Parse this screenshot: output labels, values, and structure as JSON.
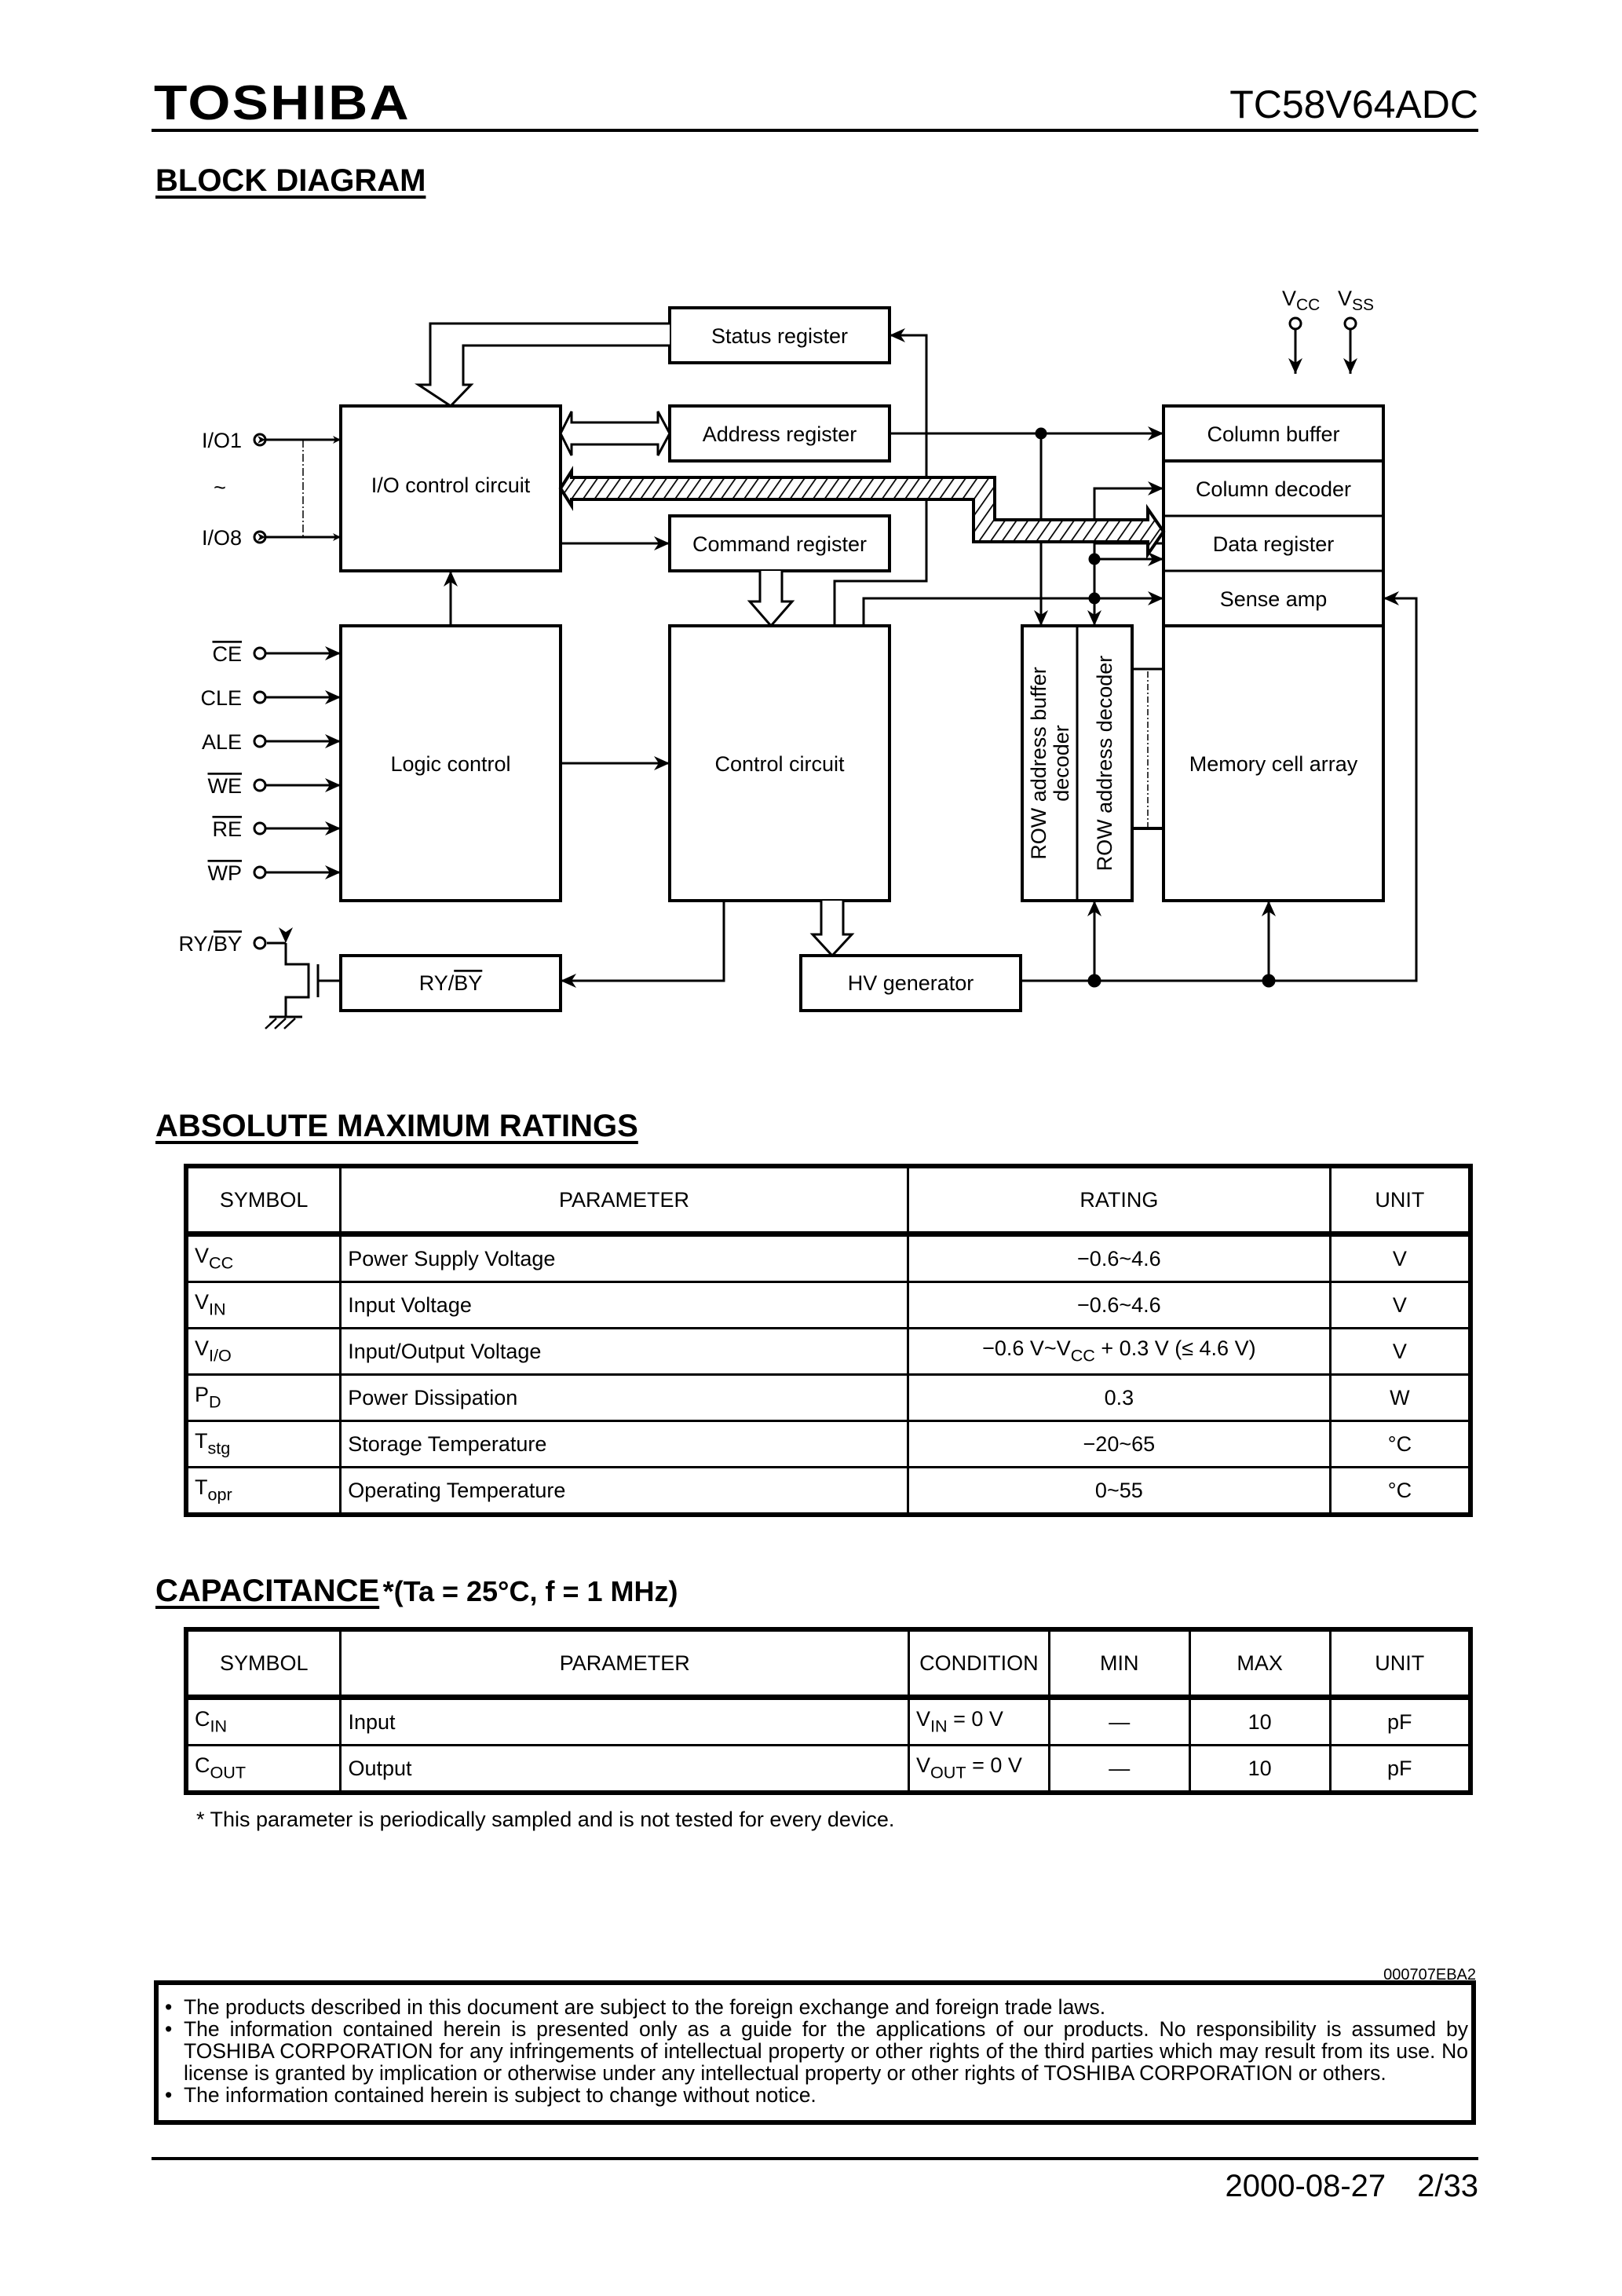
{
  "header": {
    "brand": "TOSHIBA",
    "part_number": "TC58V64ADC"
  },
  "block_diagram": {
    "title": "BLOCK DIAGRAM",
    "pins": {
      "io1": "I/O1",
      "io_tilde": "~",
      "io8": "I/O8",
      "ce": "CE",
      "cle": "CLE",
      "ale": "ALE",
      "we": "WE",
      "re": "RE",
      "wp": "WP",
      "ryby_ry": "RY/",
      "ryby_by": "BY",
      "vcc_main": "V",
      "vcc_sub": "CC",
      "vss_main": "V",
      "vss_sub": "SS"
    },
    "blocks": {
      "status_register": "Status register",
      "address_register": "Address register",
      "command_register": "Command register",
      "io_control": "I/O control circuit",
      "logic_control": "Logic control",
      "control_circuit": "Control circuit",
      "ryby_ry": "RY/",
      "ryby_by": "BY",
      "hv_generator": "HV generator",
      "column_buffer": "Column buffer",
      "column_decoder": "Column decoder",
      "data_register": "Data register",
      "sense_amp": "Sense amp",
      "memory_cell_array": "Memory cell array",
      "row_buffer_line1": "ROW address buffer",
      "row_buffer_line2": "decoder",
      "row_decoder": "ROW address decoder"
    }
  },
  "abs_max": {
    "title": "ABSOLUTE MAXIMUM RATINGS",
    "headers": [
      "SYMBOL",
      "PARAMETER",
      "RATING",
      "UNIT"
    ],
    "rows": [
      {
        "sym": "V",
        "sub": "CC",
        "param": "Power Supply Voltage",
        "rating": "−0.6~4.6",
        "unit": "V"
      },
      {
        "sym": "V",
        "sub": "IN",
        "param": "Input Voltage",
        "rating": "−0.6~4.6",
        "unit": "V"
      },
      {
        "sym": "V",
        "sub": "I/O",
        "param": "Input/Output Voltage",
        "rating_pre": "−0.6 V~V",
        "rating_sub": "CC",
        "rating_post": " + 0.3 V (≤ 4.6 V)",
        "unit": "V"
      },
      {
        "sym": "P",
        "sub": "D",
        "param": "Power Dissipation",
        "rating": "0.3",
        "unit": "W"
      },
      {
        "sym": "T",
        "sub": "stg",
        "param": "Storage Temperature",
        "rating": "−20~65",
        "unit": "°C"
      },
      {
        "sym": "T",
        "sub": "opr",
        "param": "Operating Temperature",
        "rating": "0~55",
        "unit": "°C"
      }
    ]
  },
  "capacitance": {
    "title": "CAPACITANCE",
    "condition": "*(Ta = 25°C, f = 1 MHz)",
    "headers": [
      "SYMBOL",
      "PARAMETER",
      "CONDITION",
      "MIN",
      "MAX",
      "UNIT"
    ],
    "rows": [
      {
        "sym": "C",
        "sub": "IN",
        "param": "Input",
        "cond_main": "V",
        "cond_sub": "IN",
        "cond_post": " = 0 V",
        "min": "—",
        "max": "10",
        "unit": "pF"
      },
      {
        "sym": "C",
        "sub": "OUT",
        "param": "Output",
        "cond_main": "V",
        "cond_sub": "OUT",
        "cond_post": " = 0 V",
        "min": "—",
        "max": "10",
        "unit": "pF"
      }
    ],
    "note": "* This parameter is periodically sampled and is not tested for every device."
  },
  "doc_code": "000707EBA2",
  "disclaimer": [
    "The products described in this document are subject to the foreign exchange and foreign trade laws.",
    "The information contained herein is presented only as a guide for the applications of our products. No responsibility is assumed by TOSHIBA CORPORATION for any infringements of intellectual property or other rights of the third parties which may result from its use. No license is granted by implication or otherwise under any intellectual property or other rights of TOSHIBA CORPORATION or others.",
    "The information contained herein is subject to change without notice."
  ],
  "footer": {
    "date": "2000-08-27",
    "page": "2/33"
  }
}
